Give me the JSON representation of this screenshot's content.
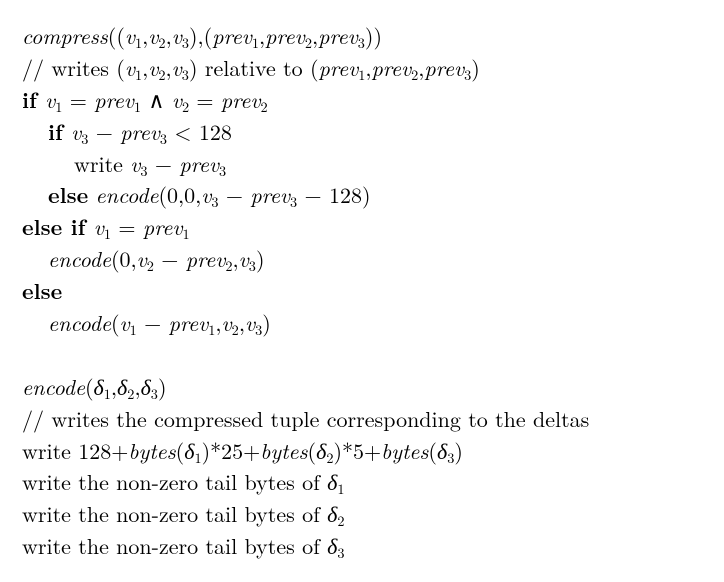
{
  "lines": {
    "l1_compress": "compress",
    "l1_p1": "((",
    "l1_v": "v",
    "l1_c": ",",
    "l1_p2": "),(",
    "l1_prev": "prev",
    "l1_p3": "))",
    "l2": "// writes (",
    "l2_rel": ") relative to (",
    "l2_end": ")",
    "kw_if": "if ",
    "kw_elseif": "else if ",
    "kw_else": "else",
    "eq": " = ",
    "and": " ∧ ",
    "minus": " − ",
    "lt": " < 128",
    "write": "write ",
    "encode": "encode",
    "l6_args_pre": "(0,0,",
    "l6_args_post": " − 128)",
    "l8_args_pre": "(0,",
    "l8_args_mid": " − ",
    "l8_args_post": ",",
    "l8_args_end": ")",
    "l10_args_pre": "(",
    "l10_args_end": ")",
    "l12_args": "(",
    "delta": "δ",
    "l12_end": ")",
    "l13": "// writes the compressed tuple corresponding to the deltas",
    "l14_pre": "write 128+",
    "bytes": "bytes",
    "l14_m25": "*25+",
    "l14_m5": "*5+",
    "tail": "write the non-zero tail bytes of "
  }
}
